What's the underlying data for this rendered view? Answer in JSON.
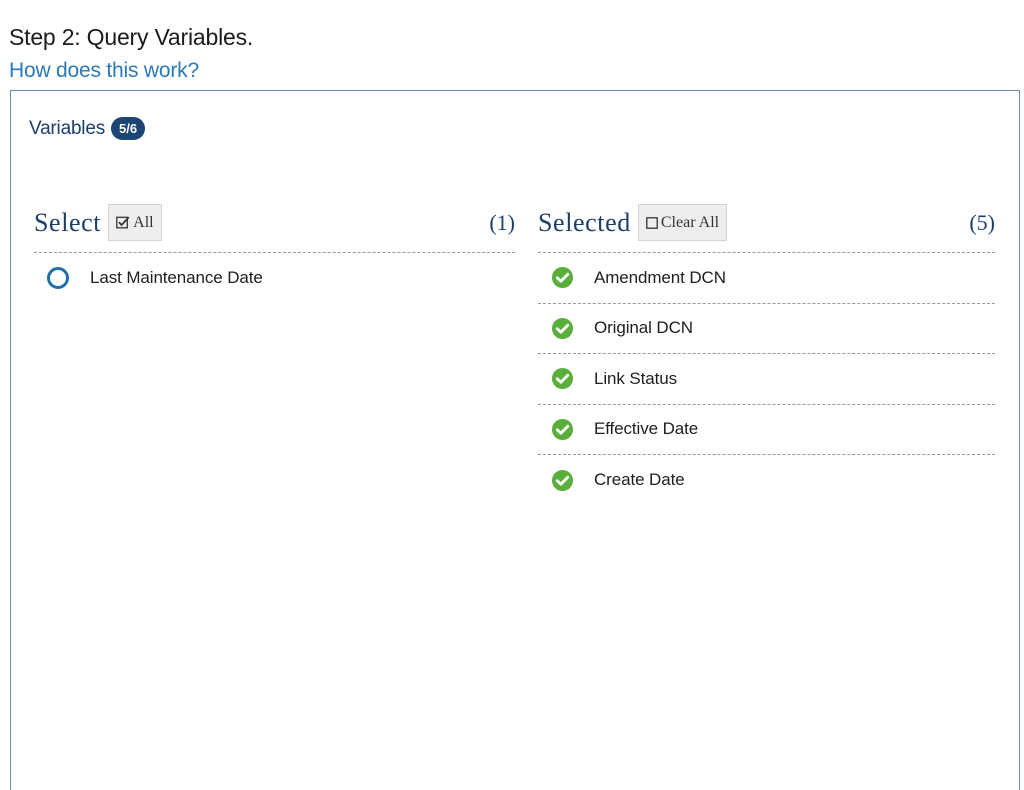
{
  "header": {
    "step_title": "Step 2: Query Variables.",
    "help_link": "How does this work?"
  },
  "panel": {
    "variables_label": "Variables",
    "variables_badge": "5/6"
  },
  "select_column": {
    "title": "Select",
    "button_label": "All",
    "button_icon": "checked-box-icon",
    "count": "(1)",
    "items": [
      {
        "label": "Last Maintenance Date",
        "icon": "empty-circle-icon"
      }
    ]
  },
  "selected_column": {
    "title": "Selected",
    "button_label": "Clear All",
    "button_icon": "empty-box-icon",
    "count": "(5)",
    "items": [
      {
        "label": "Amendment DCN",
        "icon": "check-circle-icon"
      },
      {
        "label": "Original DCN",
        "icon": "check-circle-icon"
      },
      {
        "label": "Link Status",
        "icon": "check-circle-icon"
      },
      {
        "label": "Effective Date",
        "icon": "check-circle-icon"
      },
      {
        "label": "Create Date",
        "icon": "check-circle-icon"
      }
    ]
  },
  "colors": {
    "accent_blue": "#1c4474",
    "link_blue": "#2a7ab8",
    "check_green": "#5aae3b",
    "circle_blue": "#1f6fa8"
  }
}
